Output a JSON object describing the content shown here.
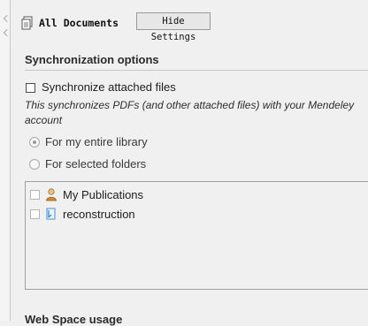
{
  "header": {
    "all_documents_label": "All Documents",
    "hide_settings_label": "Hide Settings"
  },
  "sync": {
    "section_title": "Synchronization options",
    "attached_files_label": "Synchronize attached files",
    "description": "This synchronizes PDFs (and other attached files) with your Mendeley account",
    "options": [
      {
        "label": "For my entire library",
        "selected": true
      },
      {
        "label": "For selected folders",
        "selected": false
      }
    ],
    "folders": [
      {
        "label": "My Publications",
        "icon": "person-icon"
      },
      {
        "label": "reconstruction",
        "icon": "folder-icon"
      }
    ]
  },
  "web_space": {
    "section_title": "Web Space usage"
  }
}
